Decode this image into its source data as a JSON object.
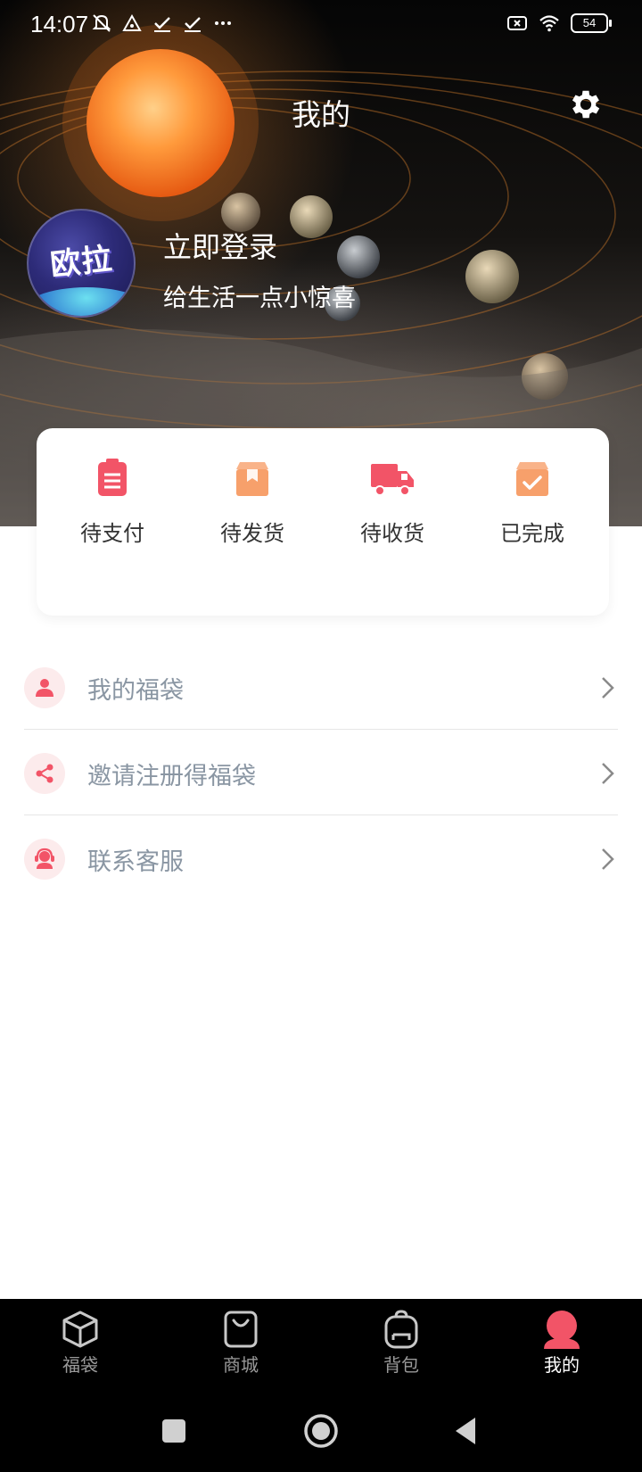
{
  "status_bar": {
    "time": "14:07",
    "battery": "54",
    "left_icons": [
      "mute-icon",
      "triangle-alert-icon",
      "check-download-icon",
      "check-download-icon",
      "more-dots-icon"
    ],
    "right_icons": [
      "sim-off-icon",
      "wifi-icon",
      "battery-icon"
    ]
  },
  "header": {
    "title": "我的",
    "settings_icon": "gear-icon"
  },
  "profile": {
    "avatar_text": "欧拉",
    "login_label": "立即登录",
    "subtitle": "给生活一点小惊喜"
  },
  "orders": {
    "items": [
      {
        "label": "待支付",
        "icon": "clipboard-icon",
        "color": "#f25467"
      },
      {
        "label": "待发货",
        "icon": "box-icon",
        "color": "#f7a06b"
      },
      {
        "label": "待收货",
        "icon": "truck-icon",
        "color": "#f25467"
      },
      {
        "label": "已完成",
        "icon": "box-check-icon",
        "color": "#f7a06b"
      }
    ]
  },
  "menu": {
    "items": [
      {
        "label": "我的福袋",
        "icon": "user-icon"
      },
      {
        "label": "邀请注册得福袋",
        "icon": "share-icon"
      },
      {
        "label": "联系客服",
        "icon": "support-agent-icon"
      }
    ]
  },
  "tab_bar": {
    "tabs": [
      {
        "label": "福袋",
        "icon": "cube-icon",
        "active": false
      },
      {
        "label": "商城",
        "icon": "shopping-bag-icon",
        "active": false
      },
      {
        "label": "背包",
        "icon": "backpack-icon",
        "active": false
      },
      {
        "label": "我的",
        "icon": "profile-icon",
        "active": true
      }
    ],
    "active_color": "#f25467"
  },
  "system_nav": [
    "recents-square-icon",
    "home-circle-icon",
    "back-triangle-icon"
  ],
  "colors": {
    "accent_red": "#f25467",
    "accent_orange": "#f7a06b",
    "menu_text": "#8a96a3"
  }
}
